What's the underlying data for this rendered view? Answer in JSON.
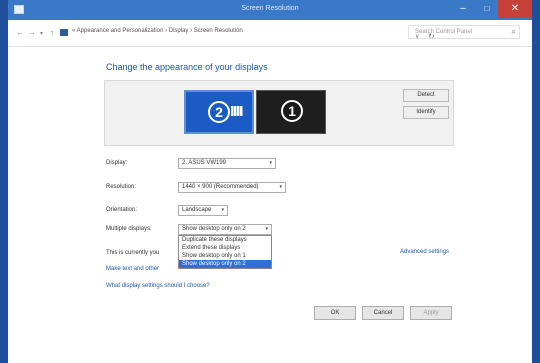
{
  "window": {
    "title": "Screen Resolution",
    "controls": {
      "minimize": "–",
      "maximize": "□",
      "close": "✕"
    }
  },
  "address": {
    "back": "←",
    "forward": "→",
    "recent": "▾",
    "up": "↑",
    "breadcrumb": "« Appearance and Personalization › Display › Screen Resolution",
    "dropdown": "∨",
    "refresh": "↻",
    "search_placeholder": "Search Control Panel",
    "search_glyph": "⌕"
  },
  "heading": "Change the appearance of your displays",
  "preview": {
    "monitors": [
      {
        "number": "2",
        "selected": true
      },
      {
        "number": "1",
        "selected": false
      }
    ],
    "detect": "Detect",
    "identify": "Identify"
  },
  "settings": {
    "display_label": "Display:",
    "display_value": "2. ASUS VW199",
    "resolution_label": "Resolution:",
    "resolution_value": "1440 × 900 (Recommended)",
    "orientation_label": "Orientation:",
    "orientation_value": "Landscape",
    "multiple_label": "Multiple displays:",
    "multiple_value": "Show desktop only on 2"
  },
  "dropdown_options": [
    {
      "label": "Duplicate these displays",
      "selected": false
    },
    {
      "label": "Extend these displays",
      "selected": false
    },
    {
      "label": "Show desktop only on 1",
      "selected": false
    },
    {
      "label": "Show desktop only on 2",
      "selected": true
    }
  ],
  "chevron": "▾",
  "current_display_text": "This is currently you",
  "links": {
    "advanced": "Advanced settings",
    "make_larger": "Make text and other",
    "which_settings": "What display settings should I choose?"
  },
  "buttons": {
    "ok": "OK",
    "cancel": "Cancel",
    "apply": "Apply"
  },
  "colors": {
    "accent": "#1e5aa6",
    "titlebar": "#3a78c8",
    "selection": "#2f6fd6",
    "close_button": "#c7413a"
  }
}
